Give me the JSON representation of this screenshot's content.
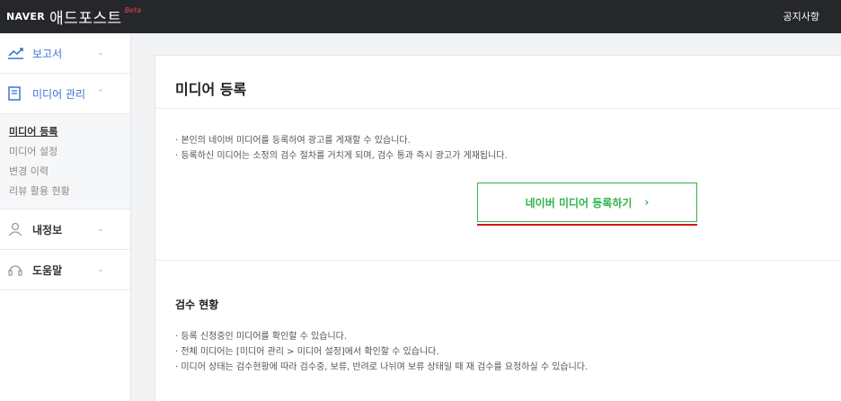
{
  "header": {
    "brand_naver": "NAVER",
    "brand_name": "애드포스트",
    "brand_beta": "Beta",
    "notice_label": "공지사항"
  },
  "sidebar": {
    "report": {
      "label": "보고서",
      "icon": "trend-chart-icon"
    },
    "media": {
      "label": "미디어 관리",
      "icon": "document-icon",
      "items": [
        "미디어 등록",
        "미디어 설정",
        "변경 이력",
        "리뷰 활용 현황"
      ]
    },
    "myinfo": {
      "label": "내정보",
      "icon": "person-icon"
    },
    "help": {
      "label": "도움말",
      "icon": "headset-icon"
    }
  },
  "main": {
    "title": "미디어 등록",
    "description": [
      "· 본인의 네이버 미디어를 등록하여 광고를 게재할 수 있습니다.",
      "· 등록하신 미디어는 소정의 검수 절차를 거치게 되며, 검수 통과 즉시 광고가 게재됩니다."
    ],
    "register_button": {
      "label": "네이버 미디어 등록하기",
      "arrow": "›"
    },
    "review": {
      "title": "검수 현황",
      "description": [
        "· 등록 신청중인 미디어를 확인할 수 있습니다.",
        "· 전체 미디어는 [미디어 관리 > 미디어 설정]에서 확인할 수 있습니다.",
        "· 미디어 상태는 검수현황에 따라 검수중, 보류, 반려로 나뉘며 보류 상태일 때 재 검수를 요청하실 수 있습니다."
      ]
    }
  },
  "colors": {
    "accent_blue": "#3b74d6",
    "accent_green": "#2fb34a",
    "highlight_red": "#d8141b",
    "topbar": "#25272b"
  }
}
